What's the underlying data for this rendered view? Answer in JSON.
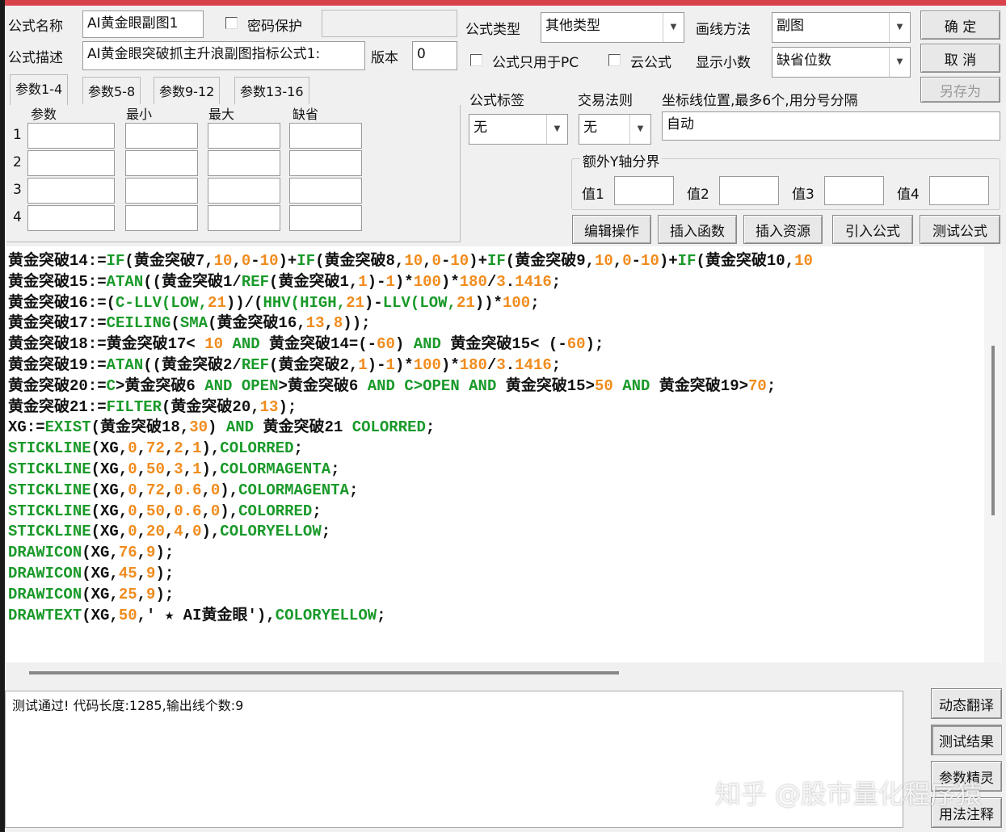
{
  "form": {
    "name_label": "公式名称",
    "name_value": "AI黄金眼副图1",
    "password_label": "密码保护",
    "password_value": "",
    "desc_label": "公式描述",
    "desc_value": "AI黄金眼突破抓主升浪副图指标公式1:",
    "version_label": "版本",
    "version_value": "0",
    "type_label": "公式类型",
    "type_value": "其他类型",
    "draw_label": "画线方法",
    "draw_value": "副图",
    "pc_only_label": "公式只用于PC",
    "cloud_label": "云公式",
    "decimal_label": "显示小数",
    "decimal_value": "缺省位数",
    "tag_label": "公式标签",
    "tag_value": "无",
    "trade_label": "交易法则",
    "trade_value": "无",
    "axis_label": "坐标线位置,最多6个,用分号分隔",
    "axis_value": "自动",
    "extra_y_label": "额外Y轴分界",
    "values": [
      {
        "label": "值1",
        "value": ""
      },
      {
        "label": "值2",
        "value": ""
      },
      {
        "label": "值3",
        "value": ""
      },
      {
        "label": "值4",
        "value": ""
      }
    ]
  },
  "buttons": {
    "ok": "确  定",
    "cancel": "取  消",
    "save_as": "另存为",
    "edit": "编辑操作",
    "insert_func": "插入函数",
    "insert_res": "插入资源",
    "import": "引入公式",
    "test": "测试公式",
    "dyn_translate": "动态翻译",
    "test_result": "测试结果",
    "param_wizard": "参数精灵",
    "usage": "用法注释"
  },
  "params": {
    "tabs": [
      "参数1-4",
      "参数5-8",
      "参数9-12",
      "参数13-16"
    ],
    "headers": [
      "参数",
      "最小",
      "最大",
      "缺省"
    ],
    "rows": [
      "1",
      "2",
      "3",
      "4"
    ]
  },
  "code_lines": [
    "黄金突破14:={g:IF}(黄金突破7,{n:10},{n:0}-{n:10})+{g:IF}(黄金突破8,{n:10},{n:0}-{n:10})+{g:IF}(黄金突破9,{n:10},{n:0}-{n:10})+{g:IF}(黄金突破10,{n:10}",
    "黄金突破15:={g:ATAN}((黄金突破1/{g:REF}(黄金突破1,{n:1})-{n:1})*{n:100})*{n:180}/{n:3}.{n:1416};",
    "黄金突破16:=({g:C-LLV(LOW,}{n:21}))/({g:HHV(HIGH,}{n:21})-{g:LLV(LOW,}{n:21}))*{n:100};",
    "黄金突破17:={g:CEILING}({g:SMA}(黄金突破16,{n:13},{n:8}));",
    "黄金突破18:=黄金突破17< {n:10} {g:AND} 黄金突破14=(-{n:60}) {g:AND} 黄金突破15< (-{n:60});",
    "黄金突破19:={g:ATAN}((黄金突破2/{g:REF}(黄金突破2,{n:1})-{n:1})*{n:100})*{n:180}/{n:3}.{n:1416};",
    "黄金突破20:={g:C}>黄金突破6 {g:AND} {g:OPEN}>黄金突破6 {g:AND} {g:C>OPEN} {g:AND} 黄金突破15>{n:50} {g:AND} 黄金突破19>{n:70};",
    "黄金突破21:={g:FILTER}(黄金突破20,{n:13});",
    "XG:={g:EXIST}(黄金突破18,{n:30}) {g:AND} 黄金突破21 {g:COLORRED};",
    "{g:STICKLINE}(XG,{n:0},{n:72},{n:2},{n:1}),{g:COLORRED};",
    "{g:STICKLINE}(XG,{n:0},{n:50},{n:3},{n:1}),{g:COLORMAGENTA};",
    "{g:STICKLINE}(XG,{n:0},{n:72},{n:0.6},{n:0}),{g:COLORMAGENTA};",
    "{g:STICKLINE}(XG,{n:0},{n:50},{n:0.6},{n:0}),{g:COLORRED};",
    "{g:STICKLINE}(XG,{n:0},{n:20},{n:4},{n:0}),{g:COLORYELLOW};",
    "{g:DRAWICON}(XG,{n:76},{n:9});",
    "{g:DRAWICON}(XG,{n:45},{n:9});",
    "{g:DRAWICON}(XG,{n:25},{n:9});",
    "{g:DRAWTEXT}(XG,{n:50},' ★ AI黄金眼'),{g:COLORYELLOW};"
  ],
  "status_text": "测试通过! 代码长度:1285,输出线个数:9",
  "watermark": "知乎 @股市量化程序猿"
}
